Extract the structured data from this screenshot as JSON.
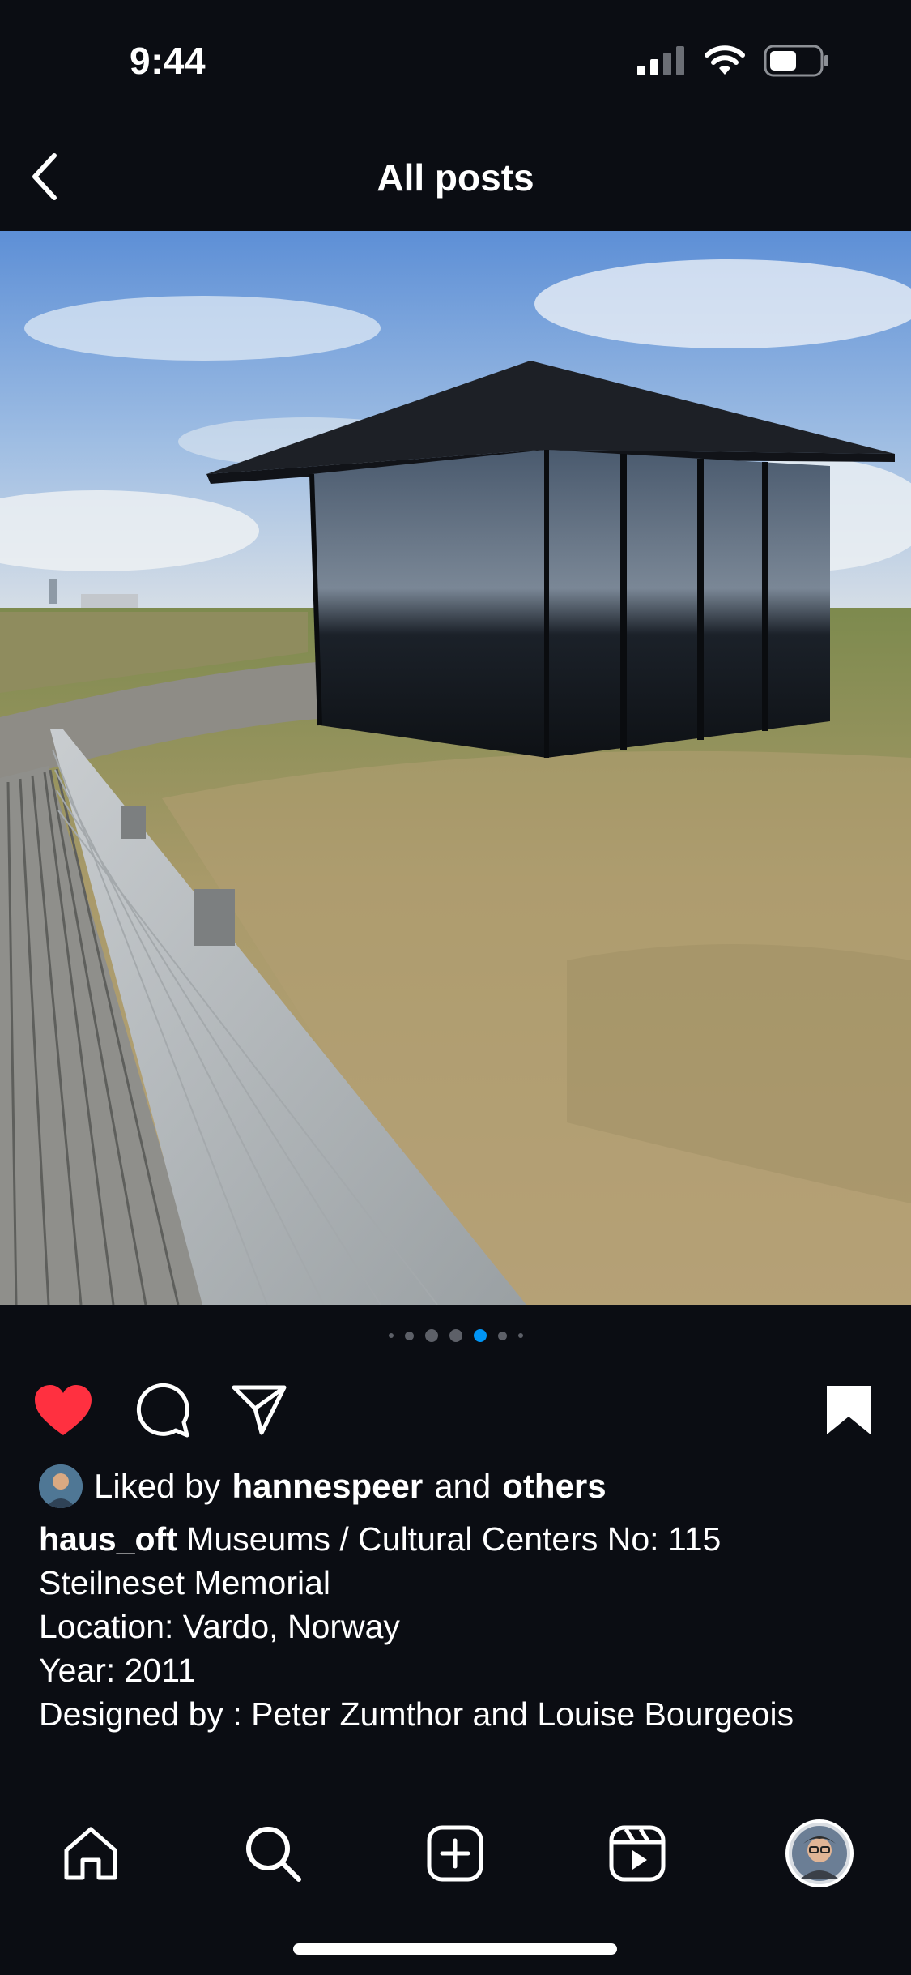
{
  "status_bar": {
    "time": "9:44"
  },
  "nav": {
    "title": "All posts"
  },
  "carousel": {
    "total": 7,
    "active_index": 4
  },
  "likes": {
    "prefix": "Liked by",
    "user": "hannespeer",
    "connector": "and",
    "suffix": "others"
  },
  "caption": {
    "username": "haus_oft",
    "first_line": "Museums / Cultural Centers No: 115",
    "lines": [
      "Steilneset Memorial",
      "Location: Vardo, Norway",
      "Year: 2011",
      "Designed by : Peter Zumthor and Louise Bourgeois"
    ]
  },
  "icons": {
    "back": "chevron-left-icon",
    "like": "heart-icon",
    "comment": "comment-icon",
    "share": "paper-plane-icon",
    "save": "bookmark-icon",
    "home": "home-icon",
    "search": "search-icon",
    "create": "plus-square-icon",
    "reels": "reels-icon",
    "profile": "profile-avatar"
  },
  "colors": {
    "background": "#0b0d13",
    "like_red": "#ff3040",
    "active_dot": "#0095f6"
  }
}
